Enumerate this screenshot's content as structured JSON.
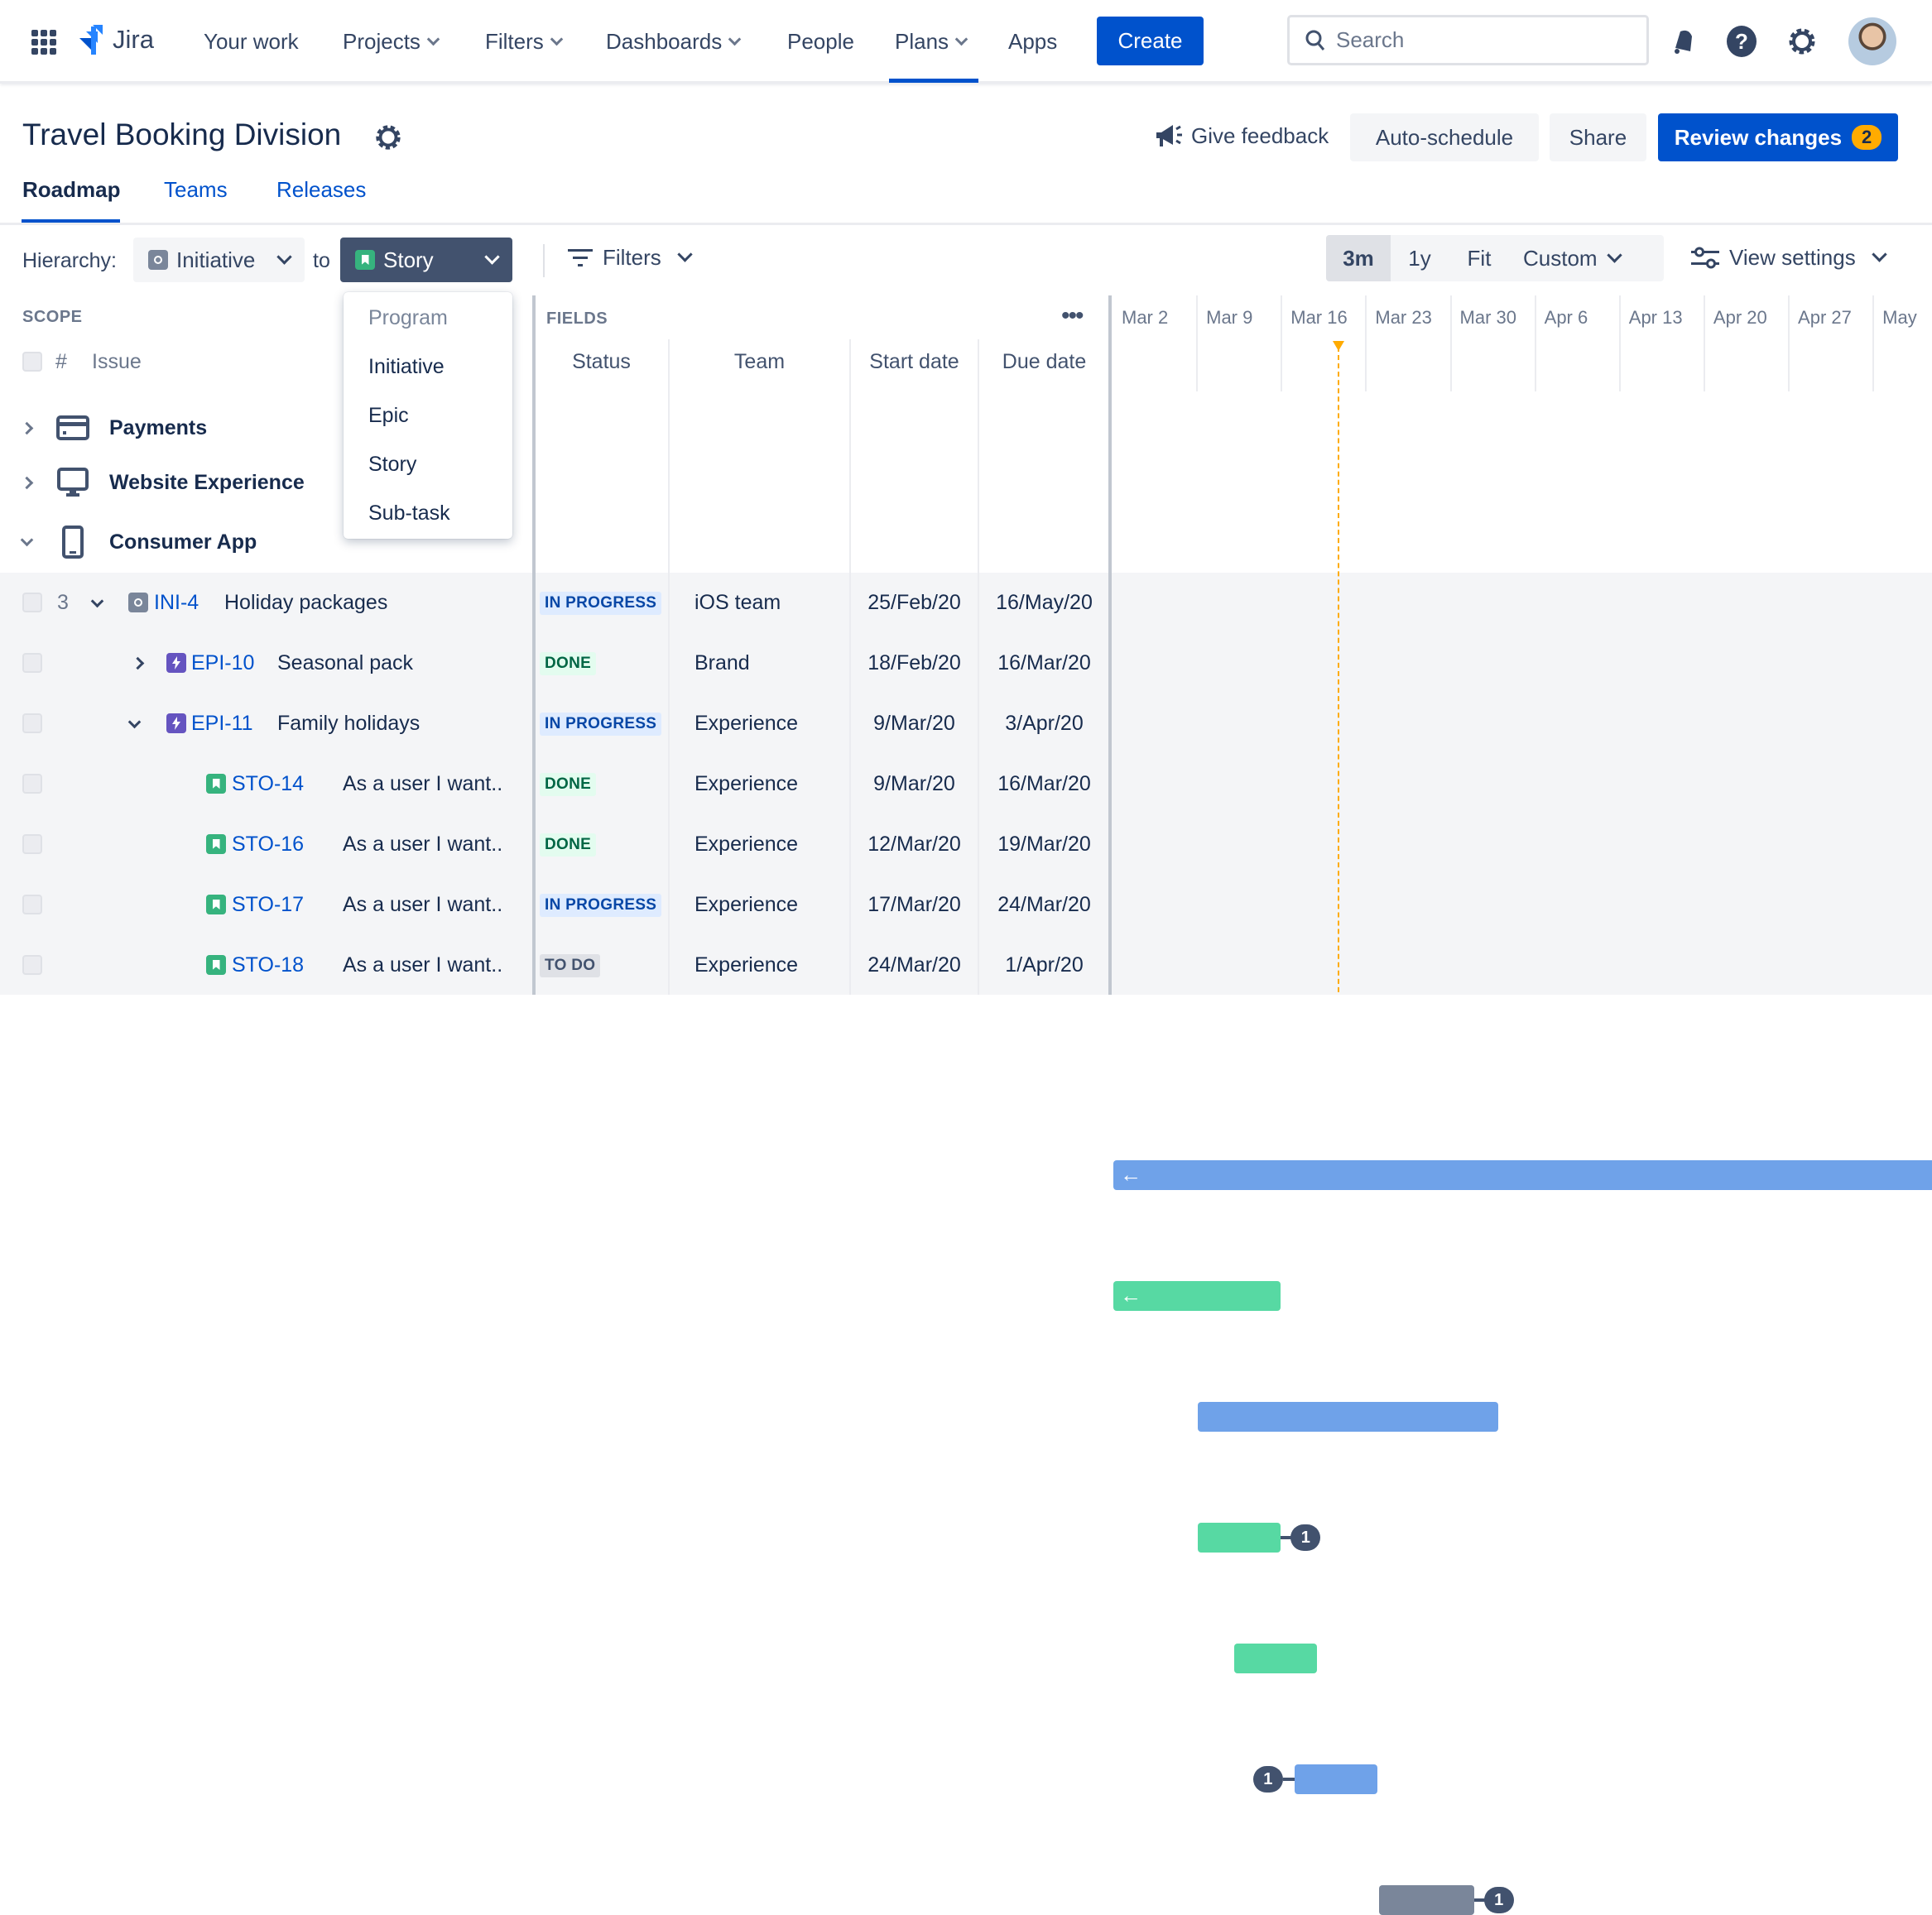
{
  "nav": {
    "product": "Jira",
    "items": [
      {
        "label": "Your work",
        "dropdown": false
      },
      {
        "label": "Projects",
        "dropdown": true
      },
      {
        "label": "Filters",
        "dropdown": true
      },
      {
        "label": "Dashboards",
        "dropdown": true
      },
      {
        "label": "People",
        "dropdown": false
      },
      {
        "label": "Plans",
        "dropdown": true,
        "active": true
      },
      {
        "label": "Apps",
        "dropdown": false
      }
    ],
    "create_label": "Create",
    "search_placeholder": "Search",
    "icons": [
      "app-switcher-icon",
      "notifications-icon",
      "help-icon",
      "settings-icon",
      "avatar"
    ]
  },
  "header": {
    "title": "Travel Booking Division",
    "give_feedback": "Give feedback",
    "auto_schedule": "Auto-schedule",
    "share": "Share",
    "review_changes": "Review changes",
    "review_count": "2",
    "tabs": [
      {
        "label": "Roadmap",
        "active": true
      },
      {
        "label": "Teams"
      },
      {
        "label": "Releases"
      }
    ]
  },
  "toolbar": {
    "hierarchy_label": "Hierarchy:",
    "from_value": "Initiative",
    "to_label": "to",
    "to_value": "Story",
    "filters_label": "Filters",
    "ranges": [
      {
        "label": "3m",
        "active": true
      },
      {
        "label": "1y"
      },
      {
        "label": "Fit"
      },
      {
        "label": "Custom"
      }
    ],
    "view_settings": "View settings"
  },
  "hierarchy_menu": {
    "options": [
      {
        "label": "Program",
        "disabled": true
      },
      {
        "label": "Initiative"
      },
      {
        "label": "Epic"
      },
      {
        "label": "Story"
      },
      {
        "label": "Sub-task"
      }
    ]
  },
  "scope": {
    "heading": "SCOPE",
    "hash": "#",
    "issue": "Issue",
    "groups": [
      {
        "label": "Payments",
        "icon": "credit-card-icon",
        "expanded": false
      },
      {
        "label": "Website Experience",
        "icon": "desktop-icon",
        "expanded": false
      },
      {
        "label": "Consumer App",
        "icon": "mobile-icon",
        "expanded": true
      }
    ]
  },
  "fields": {
    "heading": "FIELDS",
    "columns": [
      "Status",
      "Team",
      "Start date",
      "Due date"
    ]
  },
  "timeline": {
    "weeks": [
      "Mar 2",
      "Mar 9",
      "Mar 16",
      "Mar 23",
      "Mar 30",
      "Apr 6",
      "Apr 13",
      "Apr 20",
      "Apr 27",
      "May"
    ],
    "today": "20/Mar/20"
  },
  "colors": {
    "in_progress": "#6fa2e9",
    "done": "#57d9a3",
    "todo": "#7a869a",
    "brand": "#0052cc",
    "today": "#ffab00"
  },
  "issues": [
    {
      "count": "3",
      "expander": "down",
      "type": "initiative",
      "key": "INI-4",
      "summary": "Holiday packages",
      "status": "IN PROGRESS",
      "team": "iOS team",
      "start": "25/Feb/20",
      "due": "16/May/20",
      "indent": 0
    },
    {
      "expander": "right",
      "type": "epic",
      "key": "EPI-10",
      "summary": "Seasonal pack",
      "status": "DONE",
      "team": "Brand",
      "start": "18/Feb/20",
      "due": "16/Mar/20",
      "indent": 1
    },
    {
      "expander": "down",
      "type": "epic",
      "key": "EPI-11",
      "summary": "Family holidays",
      "status": "IN PROGRESS",
      "team": "Experience",
      "start": "9/Mar/20",
      "due": "3/Apr/20",
      "indent": 1
    },
    {
      "type": "story",
      "key": "STO-14",
      "summary": "As a user I want..",
      "status": "DONE",
      "team": "Experience",
      "start": "9/Mar/20",
      "due": "16/Mar/20",
      "indent": 2,
      "dependency": {
        "side": "end",
        "count": "1"
      }
    },
    {
      "type": "story",
      "key": "STO-16",
      "summary": "As a user I want..",
      "status": "DONE",
      "team": "Experience",
      "start": "12/Mar/20",
      "due": "19/Mar/20",
      "indent": 2
    },
    {
      "type": "story",
      "key": "STO-17",
      "summary": "As a user I want..",
      "status": "IN PROGRESS",
      "team": "Experience",
      "start": "17/Mar/20",
      "due": "24/Mar/20",
      "indent": 2,
      "dependency": {
        "side": "start",
        "count": "1"
      }
    },
    {
      "type": "story",
      "key": "STO-18",
      "summary": "As a user I want..",
      "status": "TO DO",
      "team": "Experience",
      "start": "24/Mar/20",
      "due": "1/Apr/20",
      "indent": 2,
      "dependency": {
        "side": "end",
        "count": "1"
      }
    }
  ]
}
